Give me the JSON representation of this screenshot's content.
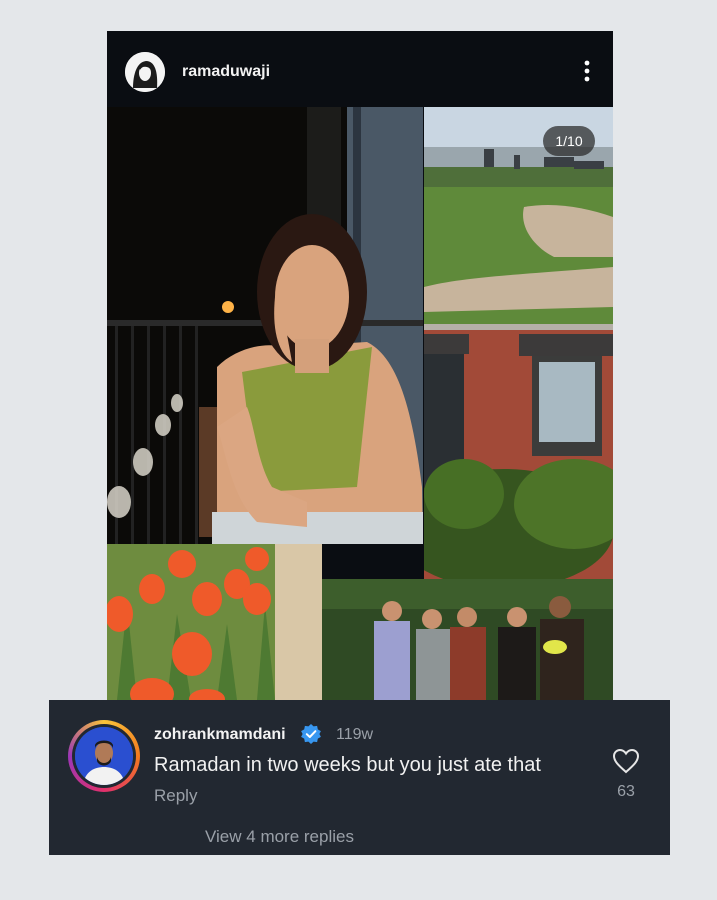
{
  "post": {
    "username": "ramaduwaji",
    "counter": "1/10",
    "photos": [
      "portrait-on-balcony",
      "park-lawn-with-skyline",
      "brick-building-window",
      "orange-tulips",
      "group-of-friends-outdoors"
    ]
  },
  "comment": {
    "username": "zohrankmamdani",
    "verified": true,
    "time": "119w",
    "text": "Ramadan in two weeks but you just ate that",
    "reply_label": "Reply",
    "likes": "63",
    "view_more_label": "View 4 more replies"
  },
  "colors": {
    "page_bg": "#e4e7ea",
    "post_bg": "#0a0d12",
    "comment_bg": "#222831",
    "verified_blue": "#3897f0",
    "muted_text": "#9aa0a8"
  },
  "icons": [
    "more-vertical-icon",
    "verified-badge-icon",
    "heart-icon"
  ]
}
